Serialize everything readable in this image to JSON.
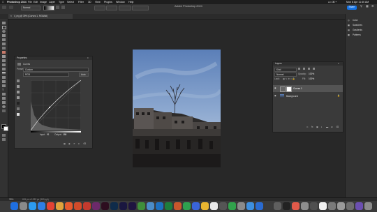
{
  "menubar": {
    "apple": "",
    "app": "Photoshop 2024",
    "items": [
      "File",
      "Edit",
      "Image",
      "Layer",
      "Type",
      "Select",
      "Filter",
      "3D",
      "View",
      "Plugins",
      "Window",
      "Help"
    ],
    "clock": "Mon 8 Apr  11:40 AM"
  },
  "optbar": {
    "window_title": "Adobe Photoshop 2024",
    "mode_label": "Normal",
    "share_label": "Share"
  },
  "doc_tab": {
    "label": "4_mg @ 39% (Curves 1, RGB/8#)"
  },
  "properties": {
    "title": "Properties",
    "sub": "Curves",
    "preset_label": "Preset:",
    "preset_value": "Custom",
    "channel_value": "RGB",
    "auto_label": "Auto",
    "input_label": "Input:",
    "input_value": "91",
    "output_label": "Output:",
    "output_value": "188"
  },
  "layers": {
    "title": "Layers",
    "filter_value": "Kind",
    "blend_value": "Normal",
    "opacity_label": "Opacity:",
    "opacity_value": "100%",
    "lock_label": "Lock:",
    "fill_label": "Fill:",
    "fill_value": "100%",
    "rows": [
      {
        "name": "Curves 1"
      },
      {
        "name": "Background"
      }
    ]
  },
  "dock": {
    "items": [
      {
        "label": "Color",
        "icon": "color-wheel-icon"
      },
      {
        "label": "Swatches",
        "icon": "swatches-icon"
      },
      {
        "label": "Gradients",
        "icon": "gradient-icon"
      },
      {
        "label": "Patterns",
        "icon": "patterns-icon"
      }
    ]
  },
  "status": {
    "zoom": "39%",
    "size": "691 px x 1032 px (300 ppi)"
  },
  "colors": {
    "accent": "#1473e6",
    "panel": "#3a3a3a",
    "bg": "#282828"
  }
}
